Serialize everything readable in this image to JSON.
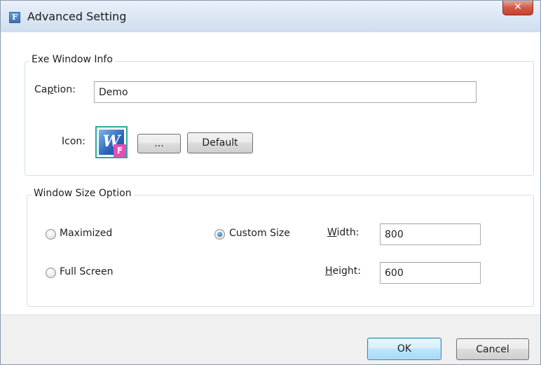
{
  "window": {
    "title": "Advanced Setting",
    "app_icon_letter": "F",
    "close_glyph": "✕"
  },
  "exe_info": {
    "legend": "Exe Window Info",
    "caption_label_pre": "Ca",
    "caption_label_mnemonic": "p",
    "caption_label_post": "tion:",
    "caption_value": "Demo",
    "icon_label": "Icon:",
    "icon_name": "exe-app-icon",
    "browse_label": "...",
    "default_label": "Default"
  },
  "size_option": {
    "legend": "Window Size Option",
    "maximized_label": "Maximized",
    "full_screen_label": "Full Screen",
    "custom_size_label": "Custom Size",
    "selected": "custom_size",
    "width_label_mnemonic": "W",
    "width_label_post": "idth:",
    "width_value": "800",
    "height_label_mnemonic": "H",
    "height_label_post": "eight:",
    "height_value": "600"
  },
  "footer": {
    "ok_label": "OK",
    "cancel_label": "Cancel"
  },
  "colors": {
    "accent_border": "#3c7fb1",
    "close_red": "#c4412c",
    "icon_frame": "#2fa89a",
    "icon_badge": "#e64db6"
  }
}
